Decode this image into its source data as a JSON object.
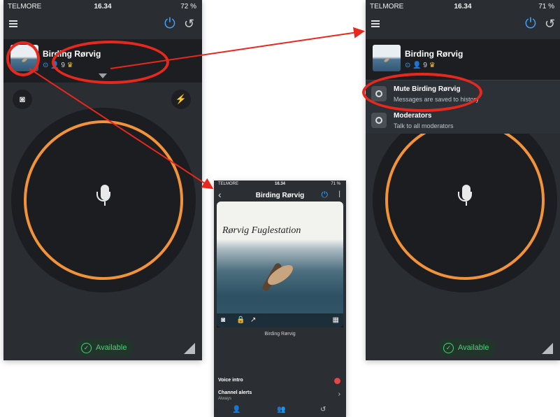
{
  "left_phone": {
    "status": {
      "carrier": "TELMORE",
      "time": "16.34",
      "battery": "72 %"
    },
    "channel_name": "Birding Rørvig",
    "members": "9",
    "available_label": "Available"
  },
  "right_phone": {
    "status": {
      "carrier": "TELMORE",
      "time": "16.34",
      "battery": "71 %"
    },
    "channel_name": "Birding Rørvig",
    "members": "9",
    "menu": [
      {
        "title": "Mute Birding Rørvig",
        "subtitle": "Messages are saved to history"
      },
      {
        "title": "Moderators",
        "subtitle": "Talk to all moderators"
      }
    ],
    "available_label": "Available"
  },
  "middle_phone": {
    "status": {
      "carrier": "TELMORE",
      "time": "16.34",
      "battery": "71 %"
    },
    "title": "Birding Rørvig",
    "photo_brand": "Rørvig Fuglestation",
    "channel_name": "Birding Rørvig",
    "rows": [
      {
        "title": "Voice intro",
        "subtitle": ""
      },
      {
        "title": "Channel alerts",
        "subtitle": "Always"
      }
    ]
  },
  "colors": {
    "accent": "#f2933a",
    "annotation": "#e8281c",
    "power": "#3ba3ff",
    "available": "#4fd07a"
  }
}
